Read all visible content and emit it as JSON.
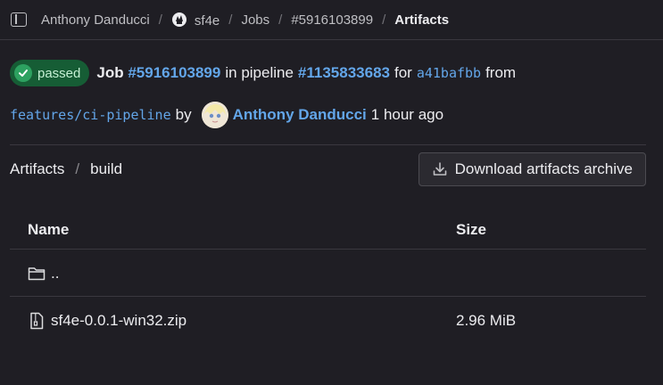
{
  "breadcrumb": {
    "items": [
      "Anthony Danducci",
      "sf4e",
      "Jobs",
      "#5916103899",
      "Artifacts"
    ],
    "separator": "/"
  },
  "job": {
    "status": "passed",
    "label": "Job",
    "job_id": "#5916103899",
    "in_pipeline": "in pipeline",
    "pipeline_id": "#1135833683",
    "for": "for",
    "commit": "a41bafbb",
    "from": "from",
    "branch": "features/ci-pipeline",
    "by": "by",
    "author": "Anthony Danducci",
    "time": "1 hour ago"
  },
  "artifacts": {
    "path_root": "Artifacts",
    "path_sep": "/",
    "path_dir": "build",
    "download_label": "Download artifacts archive"
  },
  "table": {
    "headers": {
      "name": "Name",
      "size": "Size"
    },
    "rows": [
      {
        "name": "..",
        "size": "",
        "icon": "folder-icon"
      },
      {
        "name": "sf4e-0.0.1-win32.zip",
        "size": "2.96 MiB",
        "icon": "file-zip-icon"
      }
    ]
  },
  "colors": {
    "background": "#1f1e24",
    "link": "#63a6e9",
    "badge_bg": "#165d35",
    "badge_icon": "#2da160"
  }
}
